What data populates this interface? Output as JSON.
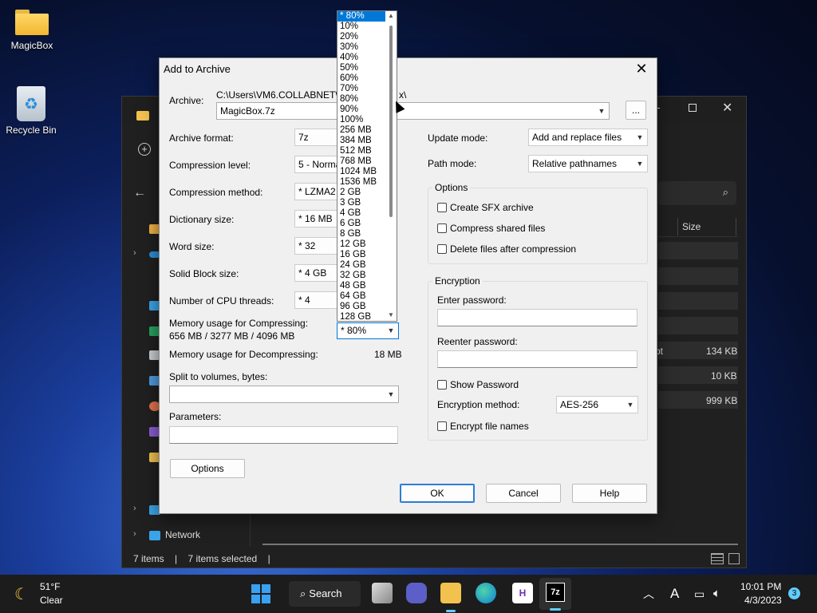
{
  "desktop": {
    "icons": [
      {
        "label": "MagicBox"
      },
      {
        "label": "Recycle Bin"
      }
    ]
  },
  "explorer": {
    "sidebar_network": "Network",
    "column_size": "Size",
    "sizes": [
      "134 KB",
      "10 KB",
      "999 KB"
    ],
    "partial_text": "pt",
    "status_items": "7 items",
    "status_selected": "7 items selected",
    "status_sep": "|"
  },
  "dialog": {
    "title": "Add to Archive",
    "close_glyph": "✕",
    "archive_label": "Archive:",
    "archive_path": "C:\\Users\\VM6.COLLABNET\\D",
    "archive_path_tail": "x\\",
    "archive_value": "MagicBox.7z",
    "browse_label": "...",
    "format_label": "Archive format:",
    "format_value": "7z",
    "level_label": "Compression level:",
    "level_value": "5 - Normal",
    "method_label": "Compression method:",
    "method_value": "*  LZMA2",
    "dict_label": "Dictionary size:",
    "dict_value": "*  16 MB",
    "word_label": "Word size:",
    "word_value": "*  32",
    "solid_label": "Solid Block size:",
    "solid_value": "*  4 GB",
    "threads_label": "Number of CPU threads:",
    "threads_value": "*  4",
    "mem_comp_label": "Memory usage for Compressing:",
    "mem_comp_value": "656 MB / 3277 MB / 4096 MB",
    "mem_combo_value": "* 80%",
    "mem_decomp_label": "Memory usage for Decompressing:",
    "mem_decomp_value": "18 MB",
    "split_label": "Split to volumes, bytes:",
    "params_label": "Parameters:",
    "options_button": "Options",
    "update_label": "Update mode:",
    "update_value": "Add and replace files",
    "path_label": "Path mode:",
    "path_value": "Relative pathnames",
    "options_group": "Options",
    "opt_sfx": "Create SFX archive",
    "opt_shared": "Compress shared files",
    "opt_delete": "Delete files after compression",
    "enc_group": "Encryption",
    "enter_pw": "Enter password:",
    "reenter_pw": "Reenter password:",
    "show_pw": "Show Password",
    "enc_method_label": "Encryption method:",
    "enc_method_value": "AES-256",
    "enc_names": "Encrypt file names",
    "ok": "OK",
    "cancel": "Cancel",
    "help": "Help"
  },
  "dropdown": {
    "items": [
      "* 80%",
      "10%",
      "20%",
      "30%",
      "40%",
      "50%",
      "60%",
      "70%",
      "80%",
      "90%",
      "100%",
      "256 MB",
      "384 MB",
      "512 MB",
      "768 MB",
      "1024 MB",
      "1536 MB",
      "2 GB",
      "3 GB",
      "4 GB",
      "6 GB",
      "8 GB",
      "12 GB",
      "16 GB",
      "24 GB",
      "32 GB",
      "48 GB",
      "64 GB",
      "96 GB",
      "128 GB"
    ]
  },
  "taskbar": {
    "weather_temp": "51°F",
    "weather_desc": "Clear",
    "search_label": "Search",
    "app_7z": "7z",
    "app_h": "H",
    "time": "10:01 PM",
    "date": "4/3/2023",
    "notif_count": "3",
    "ime": "A"
  },
  "colors": {
    "accent": "#0078d7",
    "dialog_bg": "#f0f0f0",
    "taskbar_bg": "#1c1c1c"
  }
}
